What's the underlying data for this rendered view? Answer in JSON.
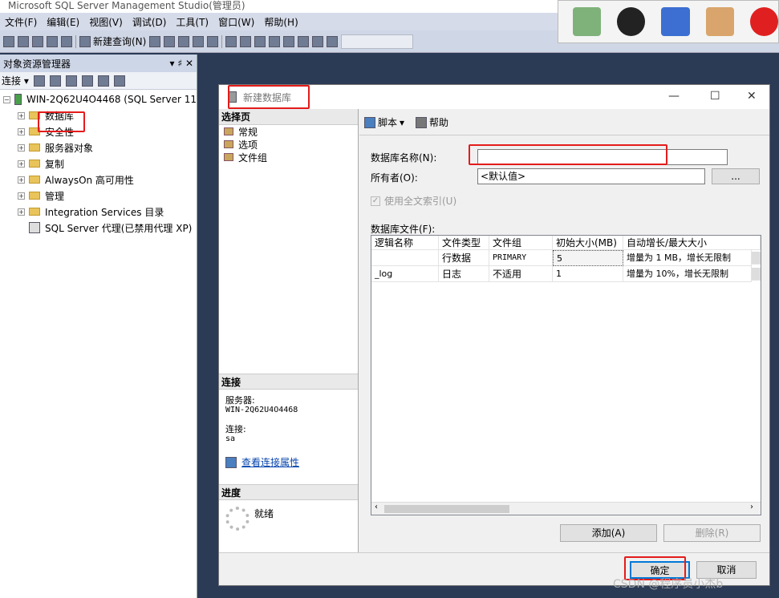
{
  "app": {
    "title": "Microsoft SQL Server Management Studio(管理员)"
  },
  "menu": [
    "文件(F)",
    "编辑(E)",
    "视图(V)",
    "调试(D)",
    "工具(T)",
    "窗口(W)",
    "帮助(H)"
  ],
  "toolbar": {
    "new_query": "新建查询(N)"
  },
  "object_explorer": {
    "title": "对象资源管理器",
    "pin": "▾ ♯ ✕",
    "connect": "连接 ▾",
    "server": "WIN-2Q62U4O4468 (SQL Server 11",
    "items": [
      "数据库",
      "安全性",
      "服务器对象",
      "复制",
      "AlwaysOn 高可用性",
      "管理",
      "Integration Services 目录"
    ],
    "agent": "SQL Server 代理(已禁用代理 XP)"
  },
  "dialog": {
    "title": "新建数据库",
    "select_page": "选择页",
    "pages": [
      "常规",
      "选项",
      "文件组"
    ],
    "connection_head": "连接",
    "server_label": "服务器:",
    "server_value": "WIN-2Q62U4O4468",
    "conn_label": "连接:",
    "conn_value": "sa",
    "view_props": "查看连接属性",
    "progress_head": "进度",
    "progress_status": "就绪",
    "script": "脚本",
    "help": "帮助",
    "db_name_label": "数据库名称(N):",
    "db_name_value": "",
    "owner_label": "所有者(O):",
    "owner_value": "<默认值>",
    "browse": "...",
    "fulltext": "使用全文索引(U)",
    "files_label": "数据库文件(F):",
    "columns": [
      "逻辑名称",
      "文件类型",
      "文件组",
      "初始大小(MB)",
      "自动增长/最大大小"
    ],
    "rows": [
      [
        "",
        "行数据",
        "PRIMARY",
        "5",
        "增量为 1 MB，增长无限制"
      ],
      [
        "_log",
        "日志",
        "不适用",
        "1",
        "增量为 10%，增长无限制"
      ]
    ],
    "add": "添加(A)",
    "remove": "删除(R)",
    "ok": "确定",
    "cancel": "取消"
  },
  "watermark": "CSDN @程序员小杰b",
  "colors": {
    "highlight": "#e41b1b",
    "link": "#0645ad"
  }
}
